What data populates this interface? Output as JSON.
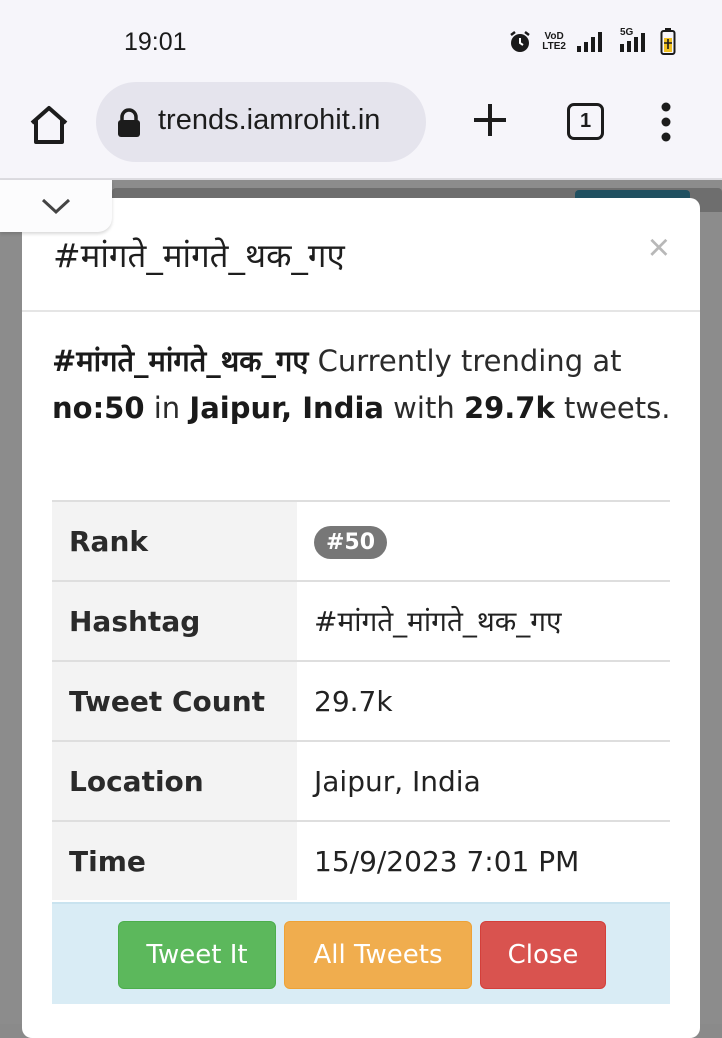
{
  "status_bar": {
    "time": "19:01",
    "network_label_top": "VoD",
    "network_label_bottom": "LTE2",
    "signal2_label": "5G",
    "icons": [
      "alarm-icon",
      "volte-icon",
      "signal-icon",
      "signal-5g-icon",
      "battery-charging-icon"
    ]
  },
  "browser": {
    "url": "trends.iamrohit.in",
    "tab_count": "1",
    "icons": [
      "home-icon",
      "lock-icon",
      "plus-icon",
      "more-vert-icon",
      "chevron-down-icon"
    ]
  },
  "modal": {
    "title": "#मांगते_मांगते_थक_गए",
    "close_glyph": "×",
    "summary": {
      "hashtag": "#मांगते_मांगते_थक_गए",
      "text1": " Currently trending at ",
      "rank_text": "no:50",
      "text2": " in ",
      "location": "Jaipur, India",
      "text3": " with ",
      "count": "29.7k",
      "text4": " tweets."
    },
    "table": [
      {
        "label": "Rank",
        "value": "#50"
      },
      {
        "label": "Hashtag",
        "value": "#मांगते_मांगते_थक_गए"
      },
      {
        "label": "Tweet Count",
        "value": "29.7k"
      },
      {
        "label": "Location",
        "value": "Jaipur, India"
      },
      {
        "label": "Time",
        "value": "15/9/2023 7:01 PM"
      }
    ],
    "buttons": {
      "tweet_it": "Tweet It",
      "all_tweets": "All Tweets",
      "close": "Close"
    },
    "colors": {
      "tweet_it": "#5cb85c",
      "all_tweets": "#f0ad4e",
      "close": "#d9534f",
      "footer": "#d9ecf5"
    }
  }
}
